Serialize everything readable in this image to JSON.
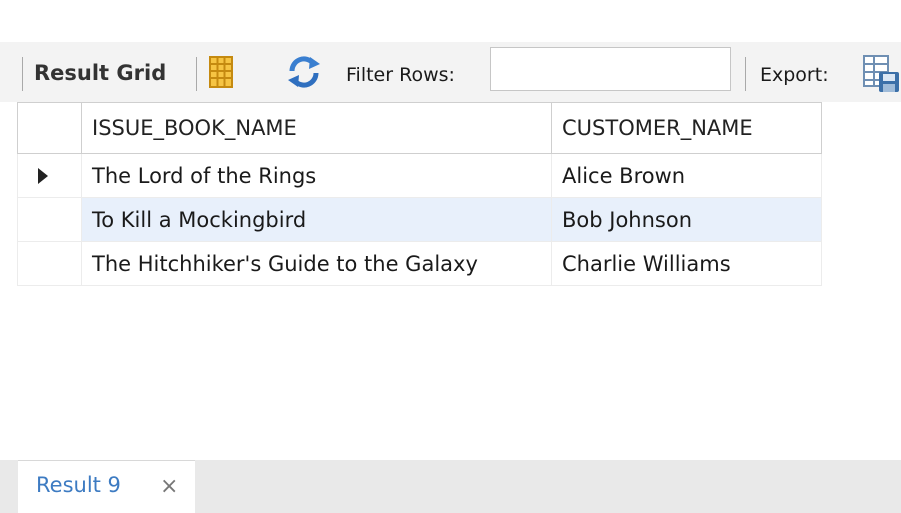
{
  "toolbar": {
    "result_grid_label": "Result Grid",
    "filter_label": "Filter Rows:",
    "filter_value": "",
    "export_label": "Export:"
  },
  "grid": {
    "columns": [
      "ISSUE_BOOK_NAME",
      "CUSTOMER_NAME"
    ],
    "rows": [
      [
        "The Lord of the Rings",
        "Alice Brown"
      ],
      [
        "To Kill a Mockingbird",
        "Bob Johnson"
      ],
      [
        "The Hitchhiker's Guide to the Galaxy",
        "Charlie Williams"
      ]
    ]
  },
  "bottom_tabs": {
    "active_label": "Result 9",
    "close_glyph": "×"
  }
}
